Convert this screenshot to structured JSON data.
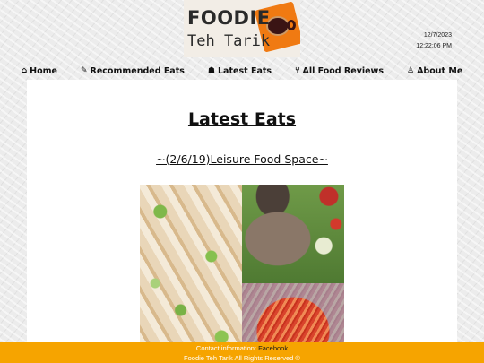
{
  "logo": {
    "line1": "FOODIE",
    "line2": "Teh Tarik"
  },
  "datetime": {
    "date": "12/7/2023",
    "time": "12:22:06 PM"
  },
  "nav": [
    {
      "icon": "home-icon",
      "glyph": "⌂",
      "label": "Home"
    },
    {
      "icon": "wrench-icon",
      "glyph": "✎",
      "label": "Recommended Eats"
    },
    {
      "icon": "bowl-icon",
      "glyph": "☗",
      "label": "Latest Eats"
    },
    {
      "icon": "cutlery-icon",
      "glyph": "⑂",
      "label": "All Food Reviews"
    },
    {
      "icon": "person-icon",
      "glyph": "♙",
      "label": "About Me"
    }
  ],
  "main": {
    "title": "Latest Eats",
    "post_title": "~(2/6/19)Leisure Food Space~"
  },
  "footer": {
    "contact_label": "Contact information:",
    "facebook_link": "Facebook",
    "rights": "Foodie Teh Tarik All Rights Reserved ©"
  },
  "colors": {
    "footer_bg": "#f6a400",
    "logo_accent": "#f07a12"
  }
}
